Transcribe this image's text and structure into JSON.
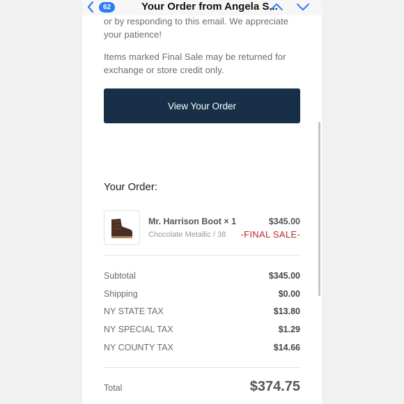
{
  "navbar": {
    "unread_count": "62",
    "title": "Your Order from Angela S..."
  },
  "body": {
    "line1": "or by responding to this email. We appreciate",
    "line2": "your patience!",
    "line3": "Items marked Final Sale may be returned for",
    "line4": "exchange or store credit only.",
    "view_order_label": "View Your Order"
  },
  "order": {
    "heading": "Your Order:",
    "item": {
      "name": "Mr. Harrison Boot × 1",
      "variant": "Chocolate Metallic / 38",
      "price": "$345.00",
      "final_sale": "-FINAL SALE-"
    },
    "summary": [
      {
        "label": "Subtotal",
        "value": "$345.00"
      },
      {
        "label": "Shipping",
        "value": "$0.00"
      },
      {
        "label": "NY STATE TAX",
        "value": "$13.80"
      },
      {
        "label": "NY SPECIAL TAX",
        "value": "$1.29"
      },
      {
        "label": "NY COUNTY TAX",
        "value": "$14.66"
      }
    ],
    "total_label": "Total",
    "total_value": "$374.75"
  },
  "colors": {
    "accent": "#2e7cf6",
    "button_bg": "#183047",
    "final_sale": "#b42a2a"
  },
  "icons": [
    "chevron-left-icon",
    "chevron-up-icon",
    "chevron-down-icon",
    "boot-icon"
  ]
}
